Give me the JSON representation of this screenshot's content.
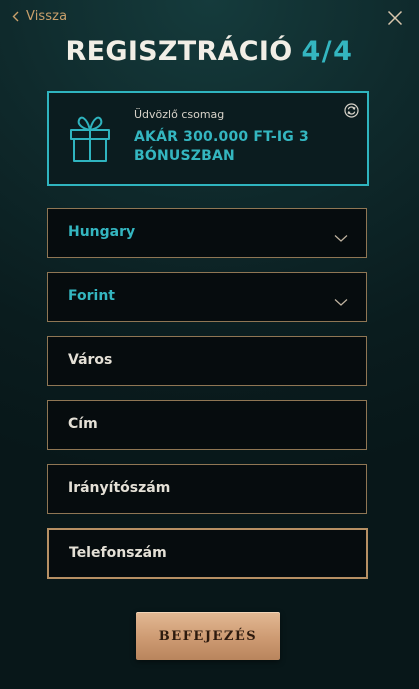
{
  "header": {
    "back_label": "Vissza",
    "title_main": "REGISZTRÁCIÓ",
    "title_step": "4/4"
  },
  "bonus": {
    "subtitle": "Üdvözlő csomag",
    "text": "AKÁR 300.000 FT-IG 3 BÓNUSZBAN"
  },
  "form": {
    "country": "Hungary",
    "currency": "Forint",
    "city_placeholder": "Város",
    "address_placeholder": "Cím",
    "zip_placeholder": "Irányítószám",
    "phone_placeholder": "Telefonszám"
  },
  "submit_label": "BEFEJEZÉS",
  "colors": {
    "accent_teal": "#34b6c0",
    "accent_gold": "#c9a06b",
    "field_border": "#8f7654",
    "button_gold": "#cf9d75"
  }
}
